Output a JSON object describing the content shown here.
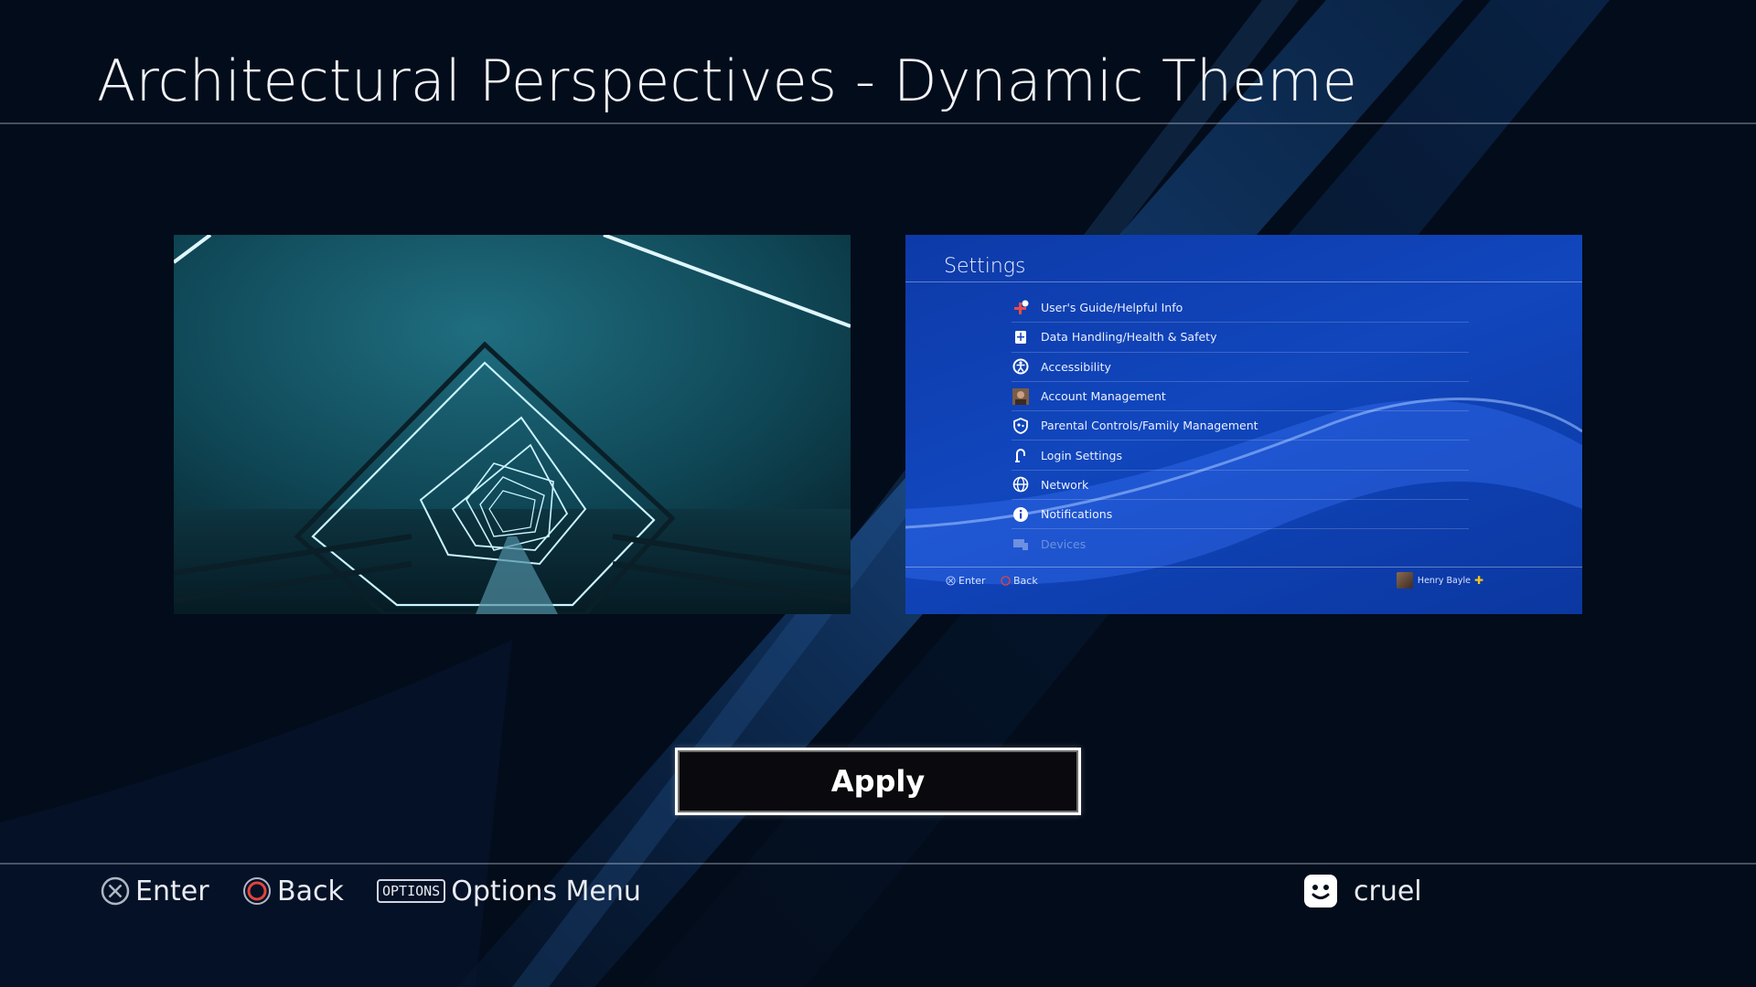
{
  "page": {
    "title": "Architectural Perspectives - Dynamic Theme"
  },
  "preview_image": {
    "description_icon": "bridge-tunnel-image"
  },
  "settings_preview": {
    "title": "Settings",
    "items": [
      {
        "label": "User's Guide/Helpful Info",
        "icon": "helpful-info-icon"
      },
      {
        "label": "Data Handling/Health & Safety",
        "icon": "data-handling-icon"
      },
      {
        "label": "Accessibility",
        "icon": "accessibility-icon"
      },
      {
        "label": "Account Management",
        "icon": "account-avatar-icon"
      },
      {
        "label": "Parental Controls/Family Management",
        "icon": "parental-controls-icon"
      },
      {
        "label": "Login Settings",
        "icon": "login-settings-icon"
      },
      {
        "label": "Network",
        "icon": "network-globe-icon"
      },
      {
        "label": "Notifications",
        "icon": "notifications-info-icon"
      },
      {
        "label": "Devices",
        "icon": "devices-icon"
      }
    ],
    "footer": {
      "enter_label": "Enter",
      "back_label": "Back",
      "user_name": "Henry Bayle"
    }
  },
  "actions": {
    "apply_label": "Apply"
  },
  "hints": {
    "enter_label": "Enter",
    "back_label": "Back",
    "options_key": "OPTIONS",
    "options_label": "Options Menu"
  },
  "user": {
    "name": "cruel"
  },
  "colors": {
    "background": "#030c1a",
    "settings_blue": "#1146bd",
    "circle_button": "#e0463b",
    "plus_gold": "#f0c420"
  }
}
